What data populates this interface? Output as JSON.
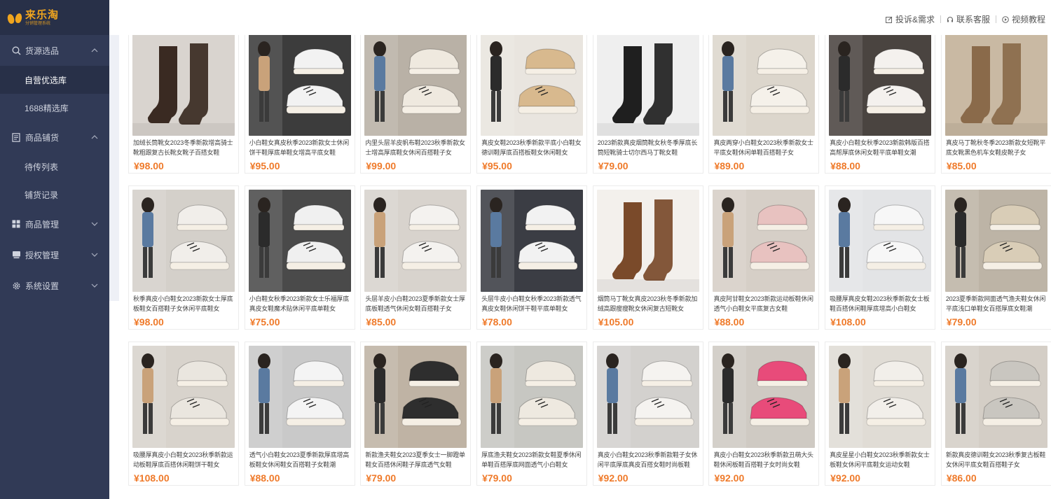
{
  "brand": {
    "name": "来乐淘",
    "subtitle": "分销管理系统"
  },
  "header": {
    "links": [
      {
        "label": "投诉&需求",
        "icon": "edit-icon"
      },
      {
        "label": "联系客服",
        "icon": "headset-icon"
      },
      {
        "label": "视频教程",
        "icon": "play-icon"
      }
    ]
  },
  "sidebar": {
    "groups": [
      {
        "label": "货源选品",
        "icon": "search-icon",
        "expanded": true,
        "items": [
          {
            "label": "自营优选库",
            "active": true
          },
          {
            "label": "1688精选库",
            "active": false
          }
        ]
      },
      {
        "label": "商品铺货",
        "icon": "document-icon",
        "expanded": true,
        "items": [
          {
            "label": "待传列表",
            "active": false
          },
          {
            "label": "铺货记录",
            "active": false
          }
        ]
      },
      {
        "label": "商品管理",
        "icon": "grid-icon",
        "expanded": false,
        "items": []
      },
      {
        "label": "授权管理",
        "icon": "card-icon",
        "expanded": false,
        "items": []
      },
      {
        "label": "系统设置",
        "icon": "gear-icon",
        "expanded": false,
        "items": []
      }
    ]
  },
  "products": [
    {
      "title": "加绒长筒靴女2023冬季新款增高骑士靴粗跟复古长靴女靴子百搭女鞋",
      "price": "¥98.00",
      "kind": "boots",
      "bg": "#d9d4cf",
      "shoe": "#3a2a22"
    },
    {
      "title": "小白鞋女真皮秋季2023新款女士休闲饼干鞋厚底单鞋女增高平底女鞋",
      "price": "¥95.00",
      "kind": "sneaker",
      "bg": "#3c3c3c",
      "shoe": "#f2f2f2"
    },
    {
      "title": "内里头层羊皮帆布鞋2023秋季新款女士增高厚底鞋女休闲百搭鞋子女",
      "price": "¥99.00",
      "kind": "sneaker",
      "bg": "#b9b1a6",
      "shoe": "#efe9df"
    },
    {
      "title": "真皮女鞋2023秋季新款平底小白鞋女德训鞋厚底百搭板鞋女休闲鞋女",
      "price": "¥95.00",
      "kind": "sneaker",
      "bg": "#e9e5df",
      "shoe": "#d8b98e"
    },
    {
      "title": "2023新款真皮烟筒靴女秋冬季厚底长筒短靴骑士切尔西马丁靴女鞋",
      "price": "¥79.00",
      "kind": "boots",
      "bg": "#efefef",
      "shoe": "#1f1f1f"
    },
    {
      "title": "真皮两穿小白鞋女2023秋季新款女士平底女鞋休闲单鞋百搭鞋子女",
      "price": "¥89.00",
      "kind": "sneaker",
      "bg": "#dcd6cc",
      "shoe": "#f5f1ea"
    },
    {
      "title": "真皮小白鞋女秋季2023新款韩版百搭高帮厚底休闲女鞋平底单鞋女潮",
      "price": "¥88.00",
      "kind": "sneaker",
      "bg": "#4a4440",
      "shoe": "#f4f1ee"
    },
    {
      "title": "真皮马丁靴秋冬季2023新款女短靴平底女靴黑色机车女鞋皮靴子女",
      "price": "¥85.00",
      "kind": "boots",
      "bg": "#c9b9a3",
      "shoe": "#8a6a4a"
    },
    {
      "title": "秋季真皮小白鞋女2023新款女士厚底板鞋女百搭鞋子女休闲平底鞋女",
      "price": "¥98.00",
      "kind": "sneaker",
      "bg": "#d4d0ca",
      "shoe": "#f1eeea"
    },
    {
      "title": "小白鞋女秋季2023新款女士乐福厚底真皮女鞋魔术贴休闲平底单鞋女",
      "price": "¥75.00",
      "kind": "sneaker",
      "bg": "#4a4a4a",
      "shoe": "#f0f0f0"
    },
    {
      "title": "头层羊皮小白鞋2023夏季新款女士厚底板鞋透气休闲女鞋百搭鞋子女",
      "price": "¥85.00",
      "kind": "sneaker",
      "bg": "#d8d3cd",
      "shoe": "#f4f2ef"
    },
    {
      "title": "头层牛皮小白鞋女秋季2023新款透气真皮女鞋休闲饼干鞋平底单鞋女",
      "price": "¥78.00",
      "kind": "sneaker",
      "bg": "#3b3d44",
      "shoe": "#f2f2f2"
    },
    {
      "title": "烟筒马丁靴女真皮2023秋冬季新款加绒高跟瘦瘦靴女休闲复古短靴女",
      "price": "¥105.00",
      "kind": "boots",
      "bg": "#f3f0ec",
      "shoe": "#7a4a2a"
    },
    {
      "title": "真皮阿甘鞋女2023新款运动板鞋休闲透气小白鞋女平底复古女鞋",
      "price": "¥88.00",
      "kind": "sneaker",
      "bg": "#d6cfc7",
      "shoe": "#e8c2c0"
    },
    {
      "title": "吸腰厚真皮女鞋2023秋季新款女士板鞋百搭休闲鞋厚底增高小白鞋女",
      "price": "¥108.00",
      "kind": "sneaker",
      "bg": "#e3e4e6",
      "shoe": "#f7f7f7"
    },
    {
      "title": "2023夏季新款网面透气渔夫鞋女休闲平底浅口单鞋女百搭厚底女鞋潮",
      "price": "¥79.00",
      "kind": "sneaker",
      "bg": "#bdb4a6",
      "shoe": "#d9cdb7"
    },
    {
      "title": "吸腰厚真皮小白鞋女2023秋季新款运动板鞋厚底百搭休闲鞋饼干鞋女",
      "price": "¥108.00",
      "kind": "sneaker",
      "bg": "#d8d3cc",
      "shoe": "#eae6df"
    },
    {
      "title": "透气小白鞋女2023夏季新款厚底增高板鞋女休闲鞋女百搭鞋子女鞋潮",
      "price": "¥88.00",
      "kind": "sneaker",
      "bg": "#c9c9c9",
      "shoe": "#f4f4f4"
    },
    {
      "title": "新款渔夫鞋女2023夏季女士一脚蹬单鞋女百搭休闲鞋子厚底透气女鞋",
      "price": "¥79.00",
      "kind": "sneaker",
      "bg": "#bfb3a4",
      "shoe": "#2e2e2e"
    },
    {
      "title": "厚底渔夫鞋女2023新款女鞋夏季休闲单鞋百搭厚底网面透气小白鞋女",
      "price": "¥79.00",
      "kind": "sneaker",
      "bg": "#c7c7c2",
      "shoe": "#eee9e0"
    },
    {
      "title": "真皮小白鞋女2023秋季新款鞋子女休闲平底厚底真皮百搭女鞋时尚板鞋",
      "price": "¥92.00",
      "kind": "sneaker",
      "bg": "#d3d1ce",
      "shoe": "#f5f3f0"
    },
    {
      "title": "真皮小白鞋女2023秋季新款丑萌大头鞋休闲板鞋百搭鞋子女时尚女鞋",
      "price": "¥92.00",
      "kind": "sneaker",
      "bg": "#cfcac3",
      "shoe": "#e84b7a"
    },
    {
      "title": "真皮星星小白鞋女2023秋季新款女士板鞋女休闲平底鞋女运动女鞋",
      "price": "¥92.00",
      "kind": "sneaker",
      "bg": "#e0dcd5",
      "shoe": "#f2efea"
    },
    {
      "title": "新款真皮德训鞋女2023秋季复古板鞋女休闲平底女鞋百搭鞋子女",
      "price": "¥86.00",
      "kind": "sneaker",
      "bg": "#d4cec6",
      "shoe": "#c9c6c0"
    }
  ]
}
